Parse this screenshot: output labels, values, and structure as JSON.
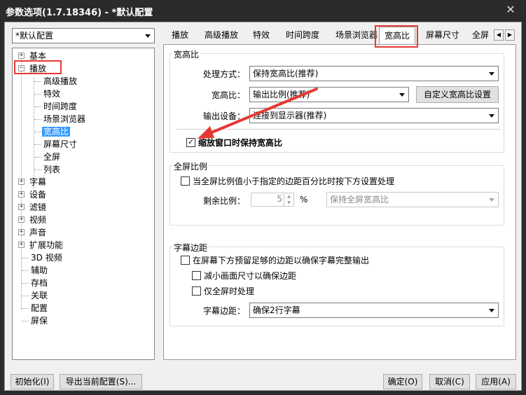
{
  "window": {
    "title": "参数选项(1.7.18346) - *默认配置",
    "close_glyph": "✕"
  },
  "profile": {
    "selected": "*默认配置"
  },
  "tree": {
    "items": [
      {
        "label": "基本",
        "expander": "+"
      },
      {
        "label": "播放",
        "expander": "−"
      },
      {
        "label": "高级播放"
      },
      {
        "label": "特效"
      },
      {
        "label": "时间跨度"
      },
      {
        "label": "场景浏览器"
      },
      {
        "label": "宽高比"
      },
      {
        "label": "屏幕尺寸"
      },
      {
        "label": "全屏"
      },
      {
        "label": "列表"
      },
      {
        "label": "字幕",
        "expander": "+"
      },
      {
        "label": "设备",
        "expander": "+"
      },
      {
        "label": "滤镜",
        "expander": "+"
      },
      {
        "label": "视频",
        "expander": "+"
      },
      {
        "label": "声音",
        "expander": "+"
      },
      {
        "label": "扩展功能",
        "expander": "+"
      },
      {
        "label": "3D 视频"
      },
      {
        "label": "辅助"
      },
      {
        "label": "存档"
      },
      {
        "label": "关联"
      },
      {
        "label": "配置"
      },
      {
        "label": "屏保"
      }
    ]
  },
  "tabs": {
    "items": [
      "播放",
      "高级播放",
      "特效",
      "时间跨度",
      "场景浏览器",
      "宽高比",
      "屏幕尺寸",
      "全屏"
    ],
    "scroll_left": "◀",
    "scroll_right": "▶"
  },
  "aspect": {
    "group_title": "宽高比",
    "method_label": "处理方式：",
    "method_value": "保持宽高比(推荐)",
    "ratio_label": "宽高比：",
    "ratio_value": "输出比例(推荐)",
    "custom_button": "自定义宽高比设置",
    "device_label": "输出设备：",
    "device_value": "连接到显示器(推荐)",
    "keep_on_resize": "缩放窗口时保持宽高比"
  },
  "fullscreen_ratio": {
    "group_title": "全屏比例",
    "check_label": "当全屏比例值小于指定的边距百分比时按下方设置处理",
    "remain_label": "剩余比例：",
    "remain_value": "5",
    "percent": "%",
    "mode_value": "保持全屏宽高比"
  },
  "subtitle_margin": {
    "group_title": "字幕边距",
    "reserve_label": "在屏幕下方预留足够的边距以确保字幕完整输出",
    "shrink_label": "减小画面尺寸以确保边距",
    "fullscreen_only_label": "仅全屏时处理",
    "margin_label": "字幕边距：",
    "margin_value": "确保2行字幕"
  },
  "footer": {
    "init": "初始化(I)",
    "export": "导出当前配置(S)...",
    "ok": "确定(O)",
    "cancel": "取消(C)",
    "apply": "应用(A)"
  },
  "colors": {
    "selection": "#3399ff",
    "annotation": "#e53935"
  }
}
